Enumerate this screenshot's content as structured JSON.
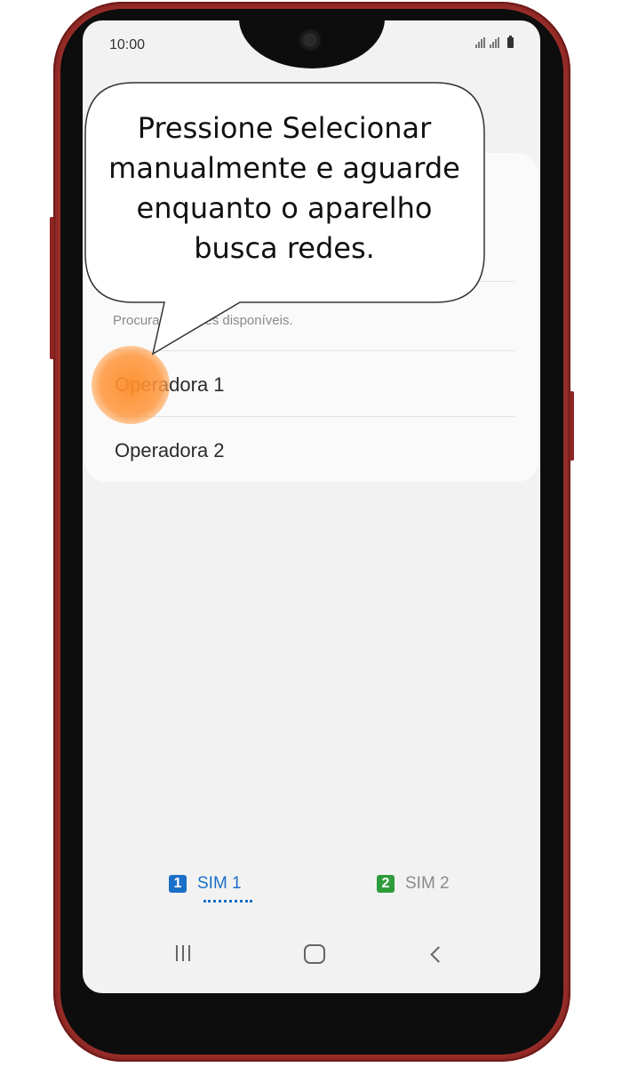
{
  "status_bar": {
    "time": "10:00"
  },
  "network_list": {
    "search_description": "Procurando redes disponíveis.",
    "operators": [
      "Operadora 1",
      "Operadora 2"
    ]
  },
  "sim_tabs": [
    {
      "badge": "1",
      "label": "SIM 1",
      "selected": true,
      "color": "#1a6fc7"
    },
    {
      "badge": "2",
      "label": "SIM 2",
      "selected": false,
      "color": "#2e9c3a"
    }
  ],
  "callout": {
    "text": "Pressione Selecionar manualmente e aguarde enquanto o aparelho busca redes."
  },
  "colors": {
    "frame": "#a5302c",
    "touch_indicator": "#ff9a40",
    "screen_bg": "#f2f2f2"
  }
}
